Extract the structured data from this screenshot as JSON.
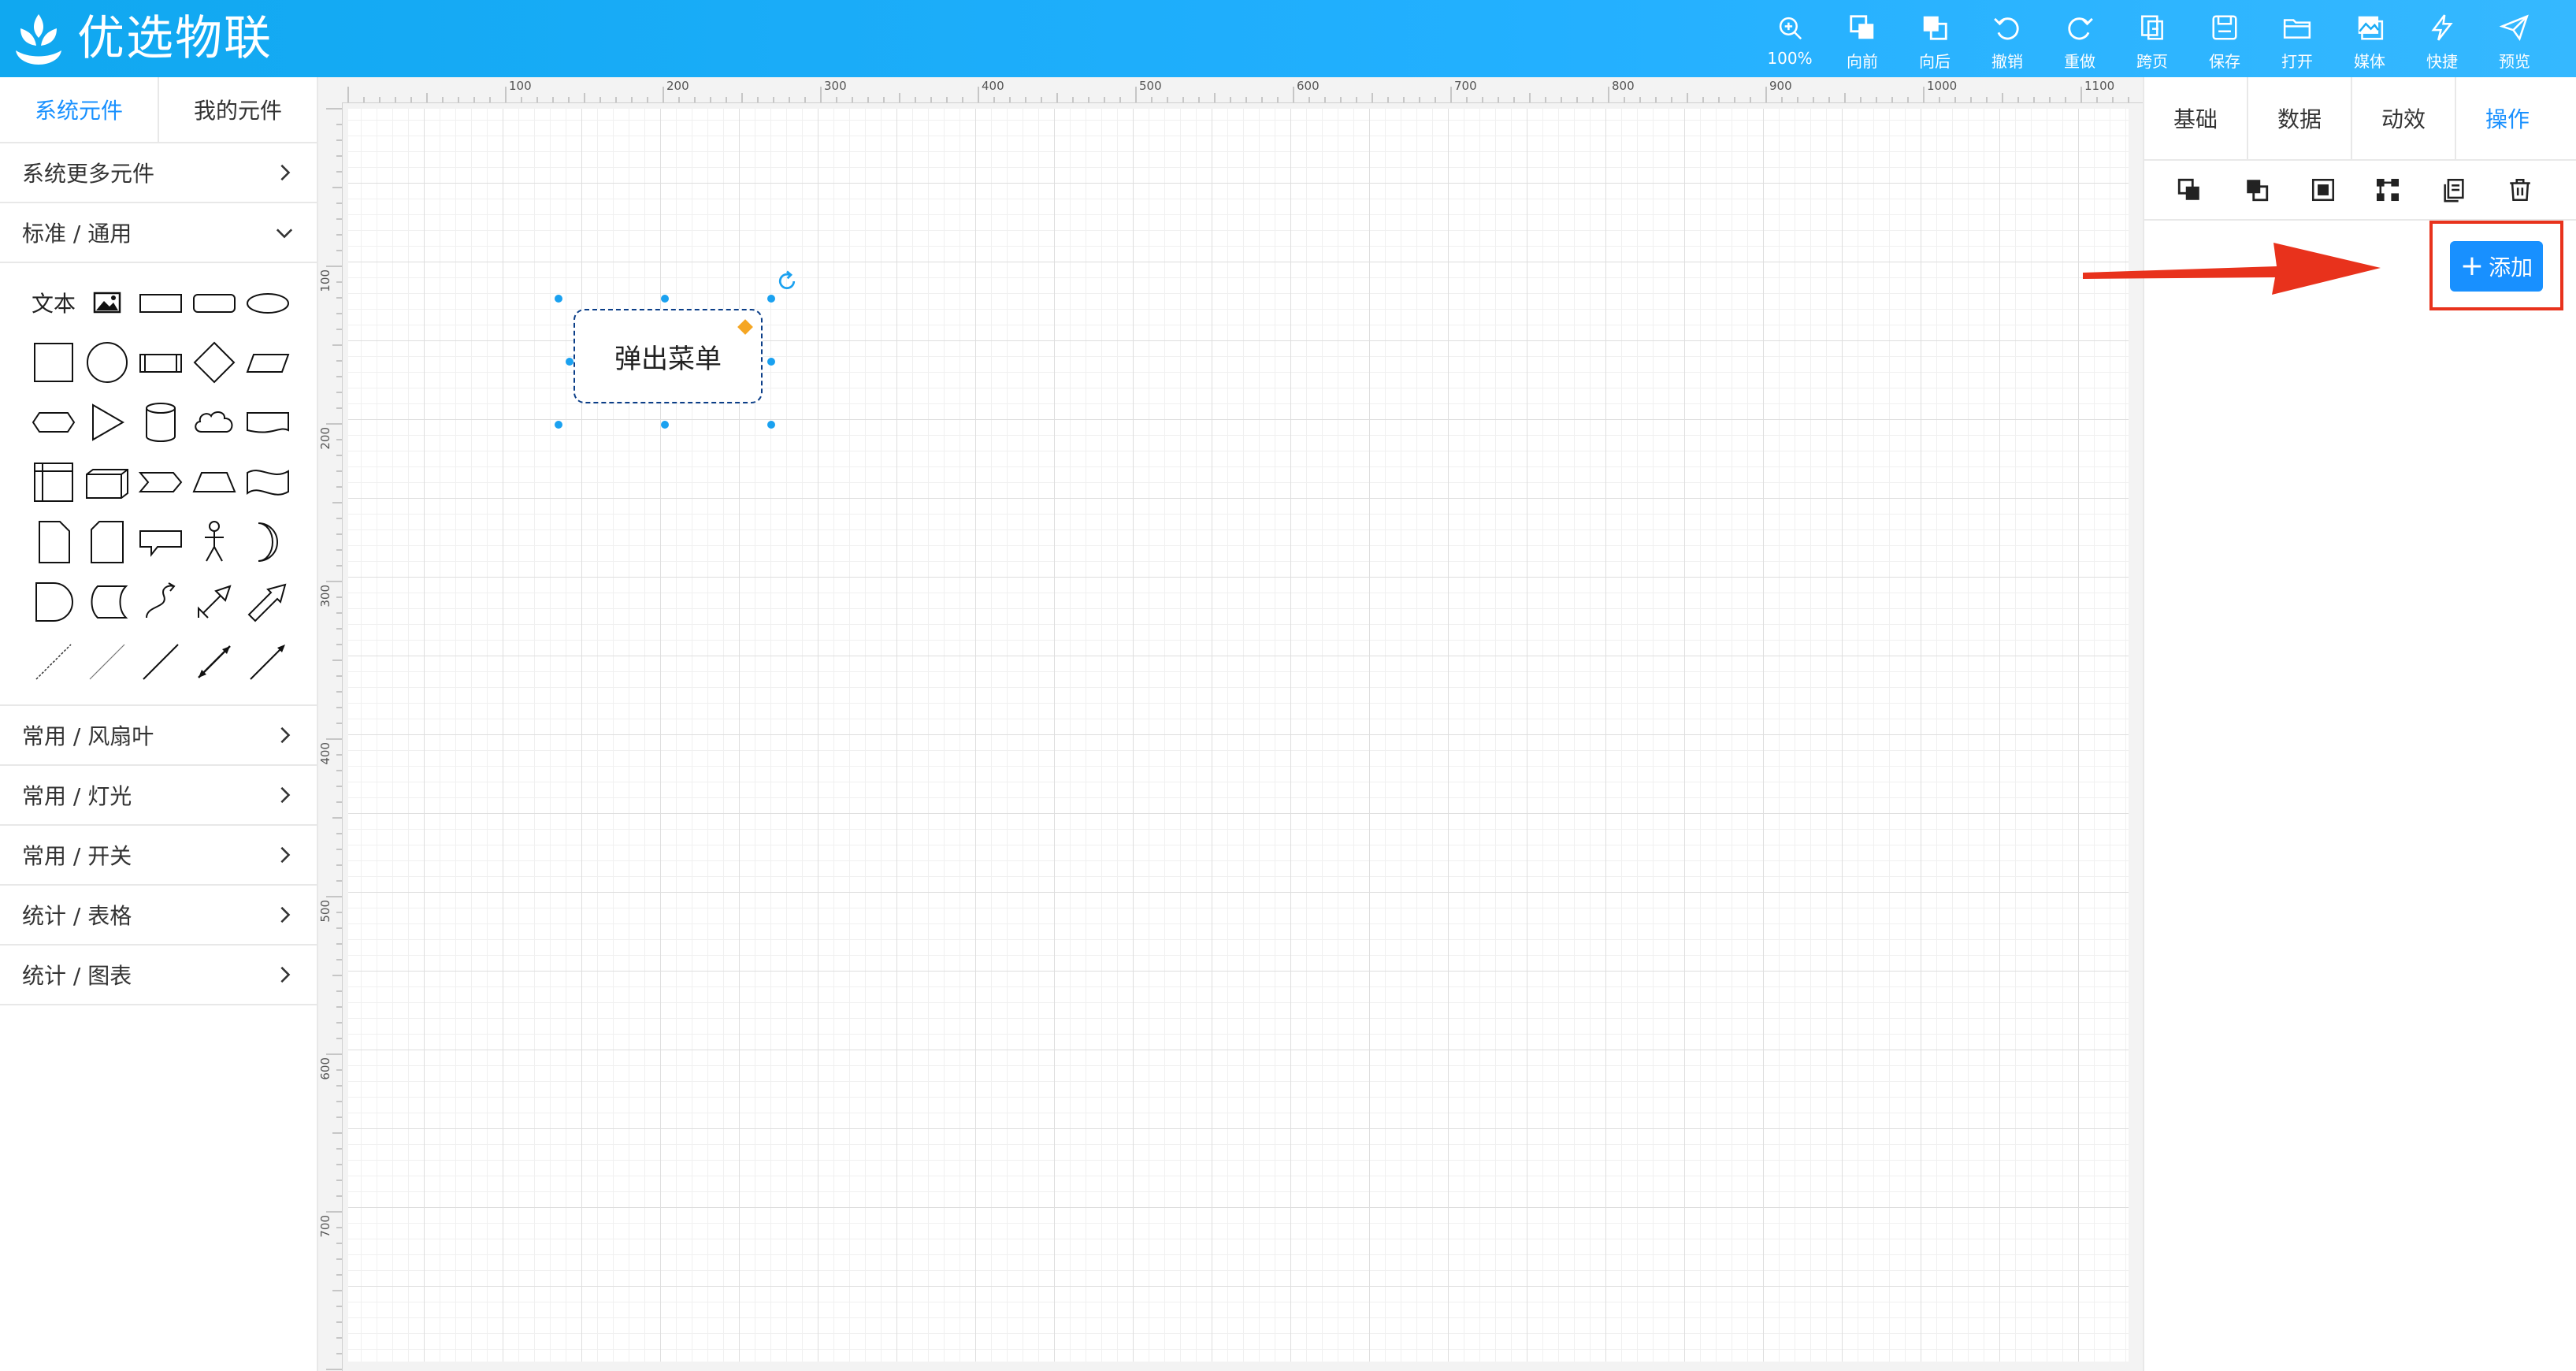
{
  "header": {
    "brand": "优选物联",
    "tools": [
      {
        "icon": "zoom-icon",
        "label": "100%"
      },
      {
        "icon": "bring-forward-icon",
        "label": "向前"
      },
      {
        "icon": "send-backward-icon",
        "label": "向后"
      },
      {
        "icon": "undo-icon",
        "label": "撤销"
      },
      {
        "icon": "redo-icon",
        "label": "重做"
      },
      {
        "icon": "cross-page-icon",
        "label": "跨页"
      },
      {
        "icon": "save-icon",
        "label": "保存"
      },
      {
        "icon": "open-folder-icon",
        "label": "打开"
      },
      {
        "icon": "media-icon",
        "label": "媒体"
      },
      {
        "icon": "lightning-icon",
        "label": "快捷"
      },
      {
        "icon": "send-icon",
        "label": "预览"
      }
    ]
  },
  "left_panel": {
    "tabs": [
      "系统元件",
      "我的元件"
    ],
    "more_components": "系统更多元件",
    "standard_section": "标准 / 通用",
    "text_shape_label": "文本",
    "categories": [
      "常用 / 风扇叶",
      "常用 / 灯光",
      "常用 / 开关",
      "统计 / 表格",
      "统计 / 图表"
    ]
  },
  "canvas": {
    "ruler_x": [
      "100",
      "200",
      "300",
      "400",
      "500",
      "600",
      "700",
      "800",
      "900",
      "1000",
      "1100"
    ],
    "ruler_y": [
      "100",
      "200",
      "300",
      "400",
      "500",
      "600",
      "700"
    ],
    "node_text": "弹出菜单"
  },
  "right_panel": {
    "tabs": [
      "基础",
      "数据",
      "动效",
      "操作"
    ],
    "active_tab": "操作",
    "add_button": "添加"
  },
  "colors": {
    "header_blue": "#1aabf5",
    "accent": "#1890ff",
    "annotation_red": "#e8321c",
    "selection_handle": "#1aa1f0",
    "anchor_orange": "#f5a623"
  }
}
